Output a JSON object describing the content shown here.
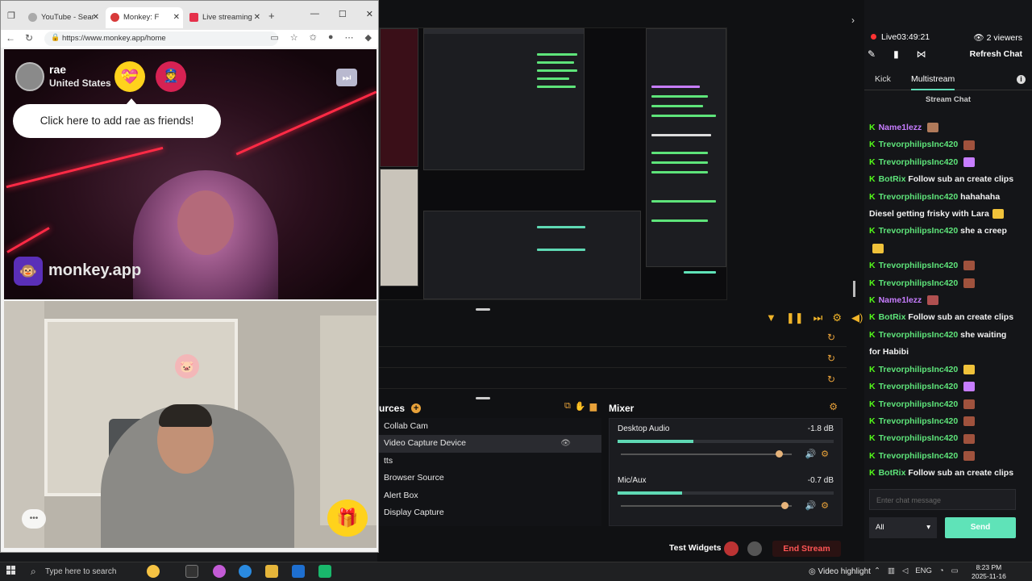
{
  "browser": {
    "tabs": [
      {
        "label": "YouTube - Sear",
        "active": false
      },
      {
        "label": "Monkey: F",
        "active": true
      },
      {
        "label": "Live streaming",
        "active": false
      }
    ],
    "new_tab": "+",
    "url": "https://www.monkey.app/home",
    "window_controls": [
      "—",
      "☐",
      "✕"
    ]
  },
  "monkey": {
    "user_name": "rae",
    "user_country": "United States",
    "friend_prompt": "Click here to add rae as friends!",
    "brand": "monkey.app",
    "skip_icon": "⏭",
    "gift_icon": "🎁"
  },
  "studio": {
    "sources_title": "urces",
    "sources": [
      {
        "label": "Collab Cam",
        "selected": false
      },
      {
        "label": "Video Capture Device",
        "selected": true
      },
      {
        "label": "tts",
        "selected": false
      },
      {
        "label": "Browser Source",
        "selected": false
      },
      {
        "label": "Alert Box",
        "selected": false
      },
      {
        "label": "Display Capture",
        "selected": false
      }
    ],
    "mixer_title": "Mixer",
    "channels": [
      {
        "name": "Desktop Audio",
        "db": "-1.8 dB",
        "level": 0.35,
        "volume": 0.93
      },
      {
        "name": "Mic/Aux",
        "db": "-0.7 dB",
        "level": 0.3,
        "volume": 0.96
      }
    ],
    "test_widgets": "Test Widgets",
    "end_stream": "End Stream"
  },
  "chat": {
    "live_label": "Live",
    "live_time": "03:49:21",
    "viewers": "2 viewers",
    "refresh": "Refresh Chat",
    "tabs": [
      {
        "label": "Kick",
        "active": false
      },
      {
        "label": "Multistream",
        "active": true
      }
    ],
    "title": "Stream Chat",
    "messages": [
      {
        "user": "Name1lezz",
        "color": "purple",
        "text": "",
        "emote": "#b07a5a"
      },
      {
        "user": "TrevorphilipsInc420",
        "color": "green",
        "text": "",
        "emote": "#a0523d"
      },
      {
        "user": "TrevorphilipsInc420",
        "color": "green",
        "text": "",
        "emote": "#c77dff"
      },
      {
        "user": "BotRix",
        "color": "green",
        "text": "Follow sub an create clips",
        "emote": ""
      },
      {
        "user": "TrevorphilipsInc420",
        "color": "green",
        "text": "hahahaha",
        "emote": ""
      },
      {
        "user": "",
        "color": "green",
        "text": "Diesel getting frisky with Lara",
        "emote": "#f0c23a"
      },
      {
        "user": "TrevorphilipsInc420",
        "color": "green",
        "text": "she a creep",
        "emote": ""
      },
      {
        "user": "",
        "color": "green",
        "text": "",
        "emote": "#f0c23a"
      },
      {
        "user": "TrevorphilipsInc420",
        "color": "green",
        "text": "",
        "emote": "#a0523d"
      },
      {
        "user": "TrevorphilipsInc420",
        "color": "green",
        "text": "",
        "emote": "#a0523d"
      },
      {
        "user": "Name1lezz",
        "color": "purple",
        "text": "",
        "emote": "#b05050"
      },
      {
        "user": "BotRix",
        "color": "green",
        "text": "Follow sub an create clips",
        "emote": ""
      },
      {
        "user": "TrevorphilipsInc420",
        "color": "green",
        "text": "she waiting",
        "emote": ""
      },
      {
        "user": "",
        "color": "green",
        "text": "for Habibi",
        "emote": ""
      },
      {
        "user": "TrevorphilipsInc420",
        "color": "green",
        "text": "",
        "emote": "#f0c23a"
      },
      {
        "user": "TrevorphilipsInc420",
        "color": "green",
        "text": "",
        "emote": "#c77dff"
      },
      {
        "user": "TrevorphilipsInc420",
        "color": "green",
        "text": "",
        "emote": "#a0523d"
      },
      {
        "user": "TrevorphilipsInc420",
        "color": "green",
        "text": "",
        "emote": "#a0523d"
      },
      {
        "user": "TrevorphilipsInc420",
        "color": "green",
        "text": "",
        "emote": "#a0523d"
      },
      {
        "user": "TrevorphilipsInc420",
        "color": "green",
        "text": "",
        "emote": "#a0523d"
      },
      {
        "user": "BotRix",
        "color": "green",
        "text": "Follow sub an create clips",
        "emote": ""
      }
    ],
    "input_placeholder": "Enter chat message",
    "filter": "All",
    "send": "Send"
  },
  "taskbar": {
    "search_placeholder": "Type here to search",
    "video_highlight": "Video highlight",
    "lang": "ENG",
    "time": "8:23 PM",
    "date": "2025-11-16"
  },
  "colors": {
    "accent": "#5fe3b8",
    "kick_green": "#53fc18",
    "warning": "#e8a23a",
    "live_red": "#ff3333"
  }
}
